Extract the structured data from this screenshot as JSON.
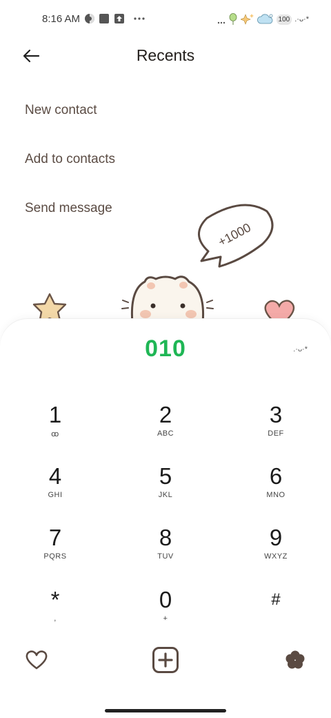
{
  "status_bar": {
    "time": "8:16 AM",
    "battery": "100",
    "kaomoji": ".·ᴗ·*",
    "left_icons": [
      "theme-icon",
      "square-icon",
      "upload-icon",
      "more-dots-icon"
    ],
    "right_icons": [
      "signal-icon",
      "balloon-icon",
      "sparkle-icon",
      "cloud-icon",
      "battery-icon"
    ]
  },
  "header": {
    "title": "Recents",
    "back_icon": "arrow-left-icon"
  },
  "menu": {
    "items": [
      {
        "label": "New contact"
      },
      {
        "label": "Add to contacts"
      },
      {
        "label": "Send message"
      }
    ]
  },
  "decoration": {
    "bubble_text": "+1000"
  },
  "dialpad": {
    "number": "010",
    "kaomoji": ".·ᴗ·*",
    "keys": [
      {
        "digit": "1",
        "letters": "ꝏ"
      },
      {
        "digit": "2",
        "letters": "ABC"
      },
      {
        "digit": "3",
        "letters": "DEF"
      },
      {
        "digit": "4",
        "letters": "GHI"
      },
      {
        "digit": "5",
        "letters": "JKL"
      },
      {
        "digit": "6",
        "letters": "MNO"
      },
      {
        "digit": "7",
        "letters": "PQRS"
      },
      {
        "digit": "8",
        "letters": "TUV"
      },
      {
        "digit": "9",
        "letters": "WXYZ"
      },
      {
        "digit": "*",
        "letters": ","
      },
      {
        "digit": "0",
        "letters": "+"
      },
      {
        "digit": "#",
        "letters": ""
      }
    ]
  },
  "bottom_bar": {
    "icons": [
      "heart-icon",
      "add-call-icon",
      "flower-icon"
    ]
  },
  "colors": {
    "accent": "#1fb655",
    "text_brown": "#5b4c44",
    "icon_brown": "#5a4a42"
  }
}
